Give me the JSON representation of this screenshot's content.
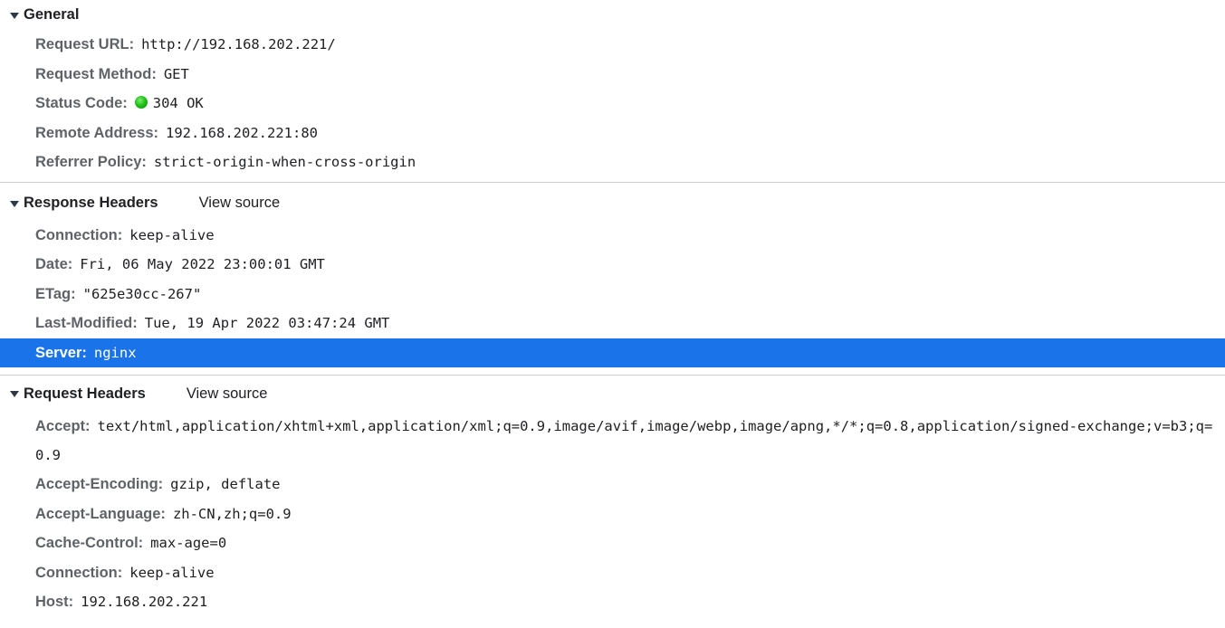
{
  "general": {
    "title": "General",
    "rows": [
      {
        "name": "Request URL:",
        "value": "http://192.168.202.221/"
      },
      {
        "name": "Request Method:",
        "value": "GET"
      },
      {
        "name": "Status Code:",
        "value": "304 OK"
      },
      {
        "name": "Remote Address:",
        "value": "192.168.202.221:80"
      },
      {
        "name": "Referrer Policy:",
        "value": "strict-origin-when-cross-origin"
      }
    ]
  },
  "response_headers": {
    "title": "Response Headers",
    "view_source": "View source",
    "rows": [
      {
        "name": "Connection:",
        "value": "keep-alive"
      },
      {
        "name": "Date:",
        "value": "Fri, 06 May 2022 23:00:01 GMT"
      },
      {
        "name": "ETag:",
        "value": "\"625e30cc-267\""
      },
      {
        "name": "Last-Modified:",
        "value": "Tue, 19 Apr 2022 03:47:24 GMT"
      },
      {
        "name": "Server:",
        "value": "nginx"
      }
    ]
  },
  "request_headers": {
    "title": "Request Headers",
    "view_source": "View source",
    "rows": [
      {
        "name": "Accept:",
        "value": "text/html,application/xhtml+xml,application/xml;q=0.9,image/avif,image/webp,image/apng,*/*;q=0.8,application/signed-exchange;v=b3;q=0.9"
      },
      {
        "name": "Accept-Encoding:",
        "value": "gzip, deflate"
      },
      {
        "name": "Accept-Language:",
        "value": "zh-CN,zh;q=0.9"
      },
      {
        "name": "Cache-Control:",
        "value": "max-age=0"
      },
      {
        "name": "Connection:",
        "value": "keep-alive"
      },
      {
        "name": "Host:",
        "value": "192.168.202.221"
      }
    ]
  },
  "colors": {
    "selection": "#1a73e8",
    "status_ok": "#23c11a"
  },
  "icons": {
    "expand": "triangle-down-icon",
    "status": "status-dot-icon"
  }
}
